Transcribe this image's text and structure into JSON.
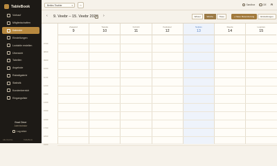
{
  "brand": {
    "name": "TableBook"
  },
  "sidebar": {
    "items": [
      {
        "label": "Vorkauf",
        "icon": "cart-icon",
        "active": false
      },
      {
        "label": "Mitgliedschaften",
        "icon": "id-card-icon",
        "active": false
      },
      {
        "label": "Kalender",
        "icon": "calendar-icon",
        "active": true
      },
      {
        "label": "Einstellungen",
        "icon": "gear-icon",
        "active": false
      },
      {
        "label": "Lootable erstellen",
        "icon": "plus-icon",
        "active": false
      },
      {
        "label": "Übersicht",
        "icon": "grid-icon",
        "active": false
      },
      {
        "label": "Tabellen",
        "icon": "table-icon",
        "active": false
      },
      {
        "label": "Angebote",
        "icon": "tag-icon",
        "active": false
      },
      {
        "label": "Rabattgalerie",
        "icon": "image-icon",
        "active": false
      },
      {
        "label": "Statistik",
        "icon": "chart-icon",
        "active": false
      },
      {
        "label": "Kundenbereich",
        "icon": "users-icon",
        "active": false
      },
      {
        "label": "Eingangsliste",
        "icon": "list-icon",
        "active": false
      }
    ],
    "user_name": "Brad Diner",
    "user_role": "Administrator",
    "logout_label": "Log entre",
    "footer_left": "Alle Rechte",
    "footer_right": "TableBook"
  },
  "topbar": {
    "location_value": "Berlins Tischler",
    "settings_label": "Sandbox",
    "language_label": "DE"
  },
  "toolbar": {
    "prev_arrow": "‹",
    "next_arrow": "›",
    "week_title": "9. Veebr – 15. Veebr 2026",
    "view_options": [
      "Wisser",
      "Woche",
      "Tisee"
    ],
    "active_view": "Woche",
    "new_reservation_label": "+ Neue Reservierung",
    "export_label": "Einstellungen"
  },
  "calendar": {
    "days": [
      {
        "name": "Zaagand",
        "num": "9",
        "today": false
      },
      {
        "name": "Taaska",
        "num": "10",
        "today": false
      },
      {
        "name": "Kolmitti",
        "num": "11",
        "today": false
      },
      {
        "name": "Kesküper",
        "num": "12",
        "today": false
      },
      {
        "name": "Neljäss",
        "num": "13",
        "today": true
      },
      {
        "name": "Reede",
        "num": "14",
        "today": false
      },
      {
        "name": "Laupäev",
        "num": "15",
        "today": false
      }
    ],
    "hours": [
      "07:00",
      "08:00",
      "09:00",
      "10:00",
      "11:00",
      "12:00",
      "13:00",
      "14:00",
      "15:00",
      "16:00",
      "17:00",
      "18:00",
      "19:00"
    ]
  }
}
